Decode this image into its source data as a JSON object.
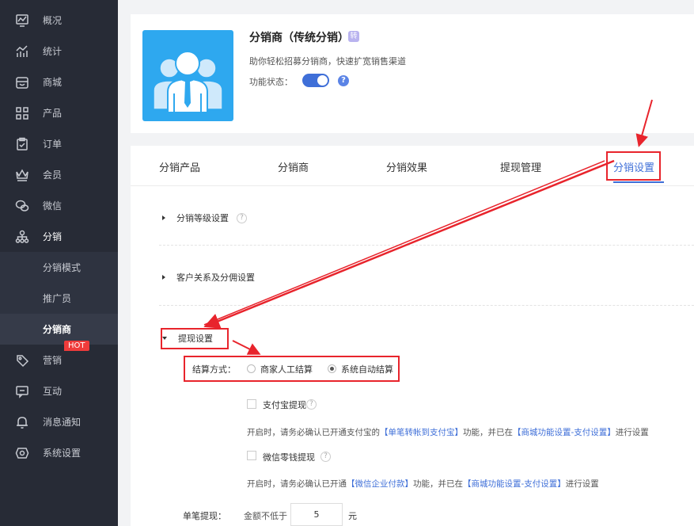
{
  "sidebar": {
    "items": [
      {
        "label": "概况",
        "icon": "monitor-chart-icon"
      },
      {
        "label": "统计",
        "icon": "stats-icon"
      },
      {
        "label": "商城",
        "icon": "shop-icon"
      },
      {
        "label": "产品",
        "icon": "grid-icon"
      },
      {
        "label": "订单",
        "icon": "clipboard-icon"
      },
      {
        "label": "会员",
        "icon": "crown-icon"
      },
      {
        "label": "微信",
        "icon": "wechat-icon"
      },
      {
        "label": "分销",
        "icon": "hierarchy-icon"
      },
      {
        "label": "营销",
        "icon": "tag-icon"
      },
      {
        "label": "互动",
        "icon": "chat-icon"
      },
      {
        "label": "消息通知",
        "icon": "bell-icon"
      },
      {
        "label": "系统设置",
        "icon": "settings-icon"
      }
    ],
    "sub_items": [
      {
        "label": "分销模式"
      },
      {
        "label": "推广员"
      },
      {
        "label": "分销商"
      }
    ],
    "hot_badge": "HOT"
  },
  "app": {
    "title": "分销商（传统分销）",
    "badge": "转",
    "description": "助你轻松招募分销商，快速扩宽销售渠道",
    "status_label": "功能状态：",
    "status_on": true,
    "help": "?"
  },
  "tabs": [
    {
      "label": "分销产品"
    },
    {
      "label": "分销商"
    },
    {
      "label": "分销效果"
    },
    {
      "label": "提现管理"
    },
    {
      "label": "分销设置"
    }
  ],
  "sections": {
    "level": {
      "label": "分销等级设置",
      "help": "?"
    },
    "relation": {
      "label": "客户关系及分佣设置"
    },
    "withdraw": {
      "label": "提现设置"
    }
  },
  "settlement": {
    "label": "结算方式：",
    "options": [
      "商家人工结算",
      "系统自动结算"
    ],
    "selected": "系统自动结算"
  },
  "alipay": {
    "label": "支付宝提现",
    "help": "?",
    "note_prefix": "开启时，请务必确认已开通支付宝的",
    "note_link1": "【单笔转帐到支付宝】",
    "note_mid": "功能，并已在",
    "note_link2": "【商城功能设置-支付设置】",
    "note_suffix": "进行设置"
  },
  "wechat": {
    "label": "微信零钱提现",
    "help": "?",
    "note_prefix": "开启时，请务必确认已开通",
    "note_link1": "【微信企业付款】",
    "note_mid": "功能，并已在",
    "note_link2": "【商城功能设置-支付设置】",
    "note_suffix": "进行设置"
  },
  "single": {
    "label": "单笔提现：",
    "min_label": "金额不低于",
    "value": "5",
    "unit": "元"
  },
  "colors": {
    "accent": "#3f6fd8",
    "sidebar": "#272b36",
    "annotation": "#e8242c"
  }
}
